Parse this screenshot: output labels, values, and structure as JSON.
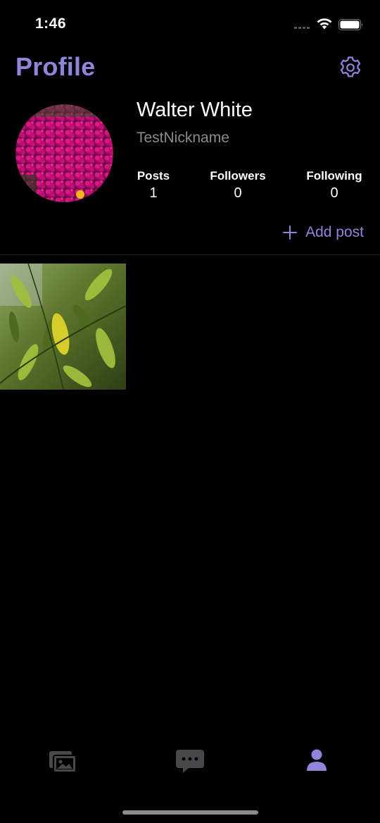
{
  "status_bar": {
    "time": "1:46"
  },
  "header": {
    "title": "Profile",
    "settings_icon": "gear-icon",
    "accent_color": "#8f86dc"
  },
  "profile": {
    "name": "Walter White",
    "nickname": "TestNickname",
    "avatar_description": "magenta flowers photo",
    "stats": {
      "posts_label": "Posts",
      "posts_value": "1",
      "followers_label": "Followers",
      "followers_value": "0",
      "following_label": "Following",
      "following_value": "0"
    }
  },
  "actions": {
    "add_post_icon": "plus-icon",
    "add_post_label": "Add post"
  },
  "posts": [
    {
      "thumbnail": "green leaves photo"
    }
  ],
  "tab_bar": {
    "items": [
      {
        "icon": "photos-icon",
        "active": false
      },
      {
        "icon": "chat-bubble-icon",
        "active": false
      },
      {
        "icon": "person-icon",
        "active": true
      }
    ]
  }
}
